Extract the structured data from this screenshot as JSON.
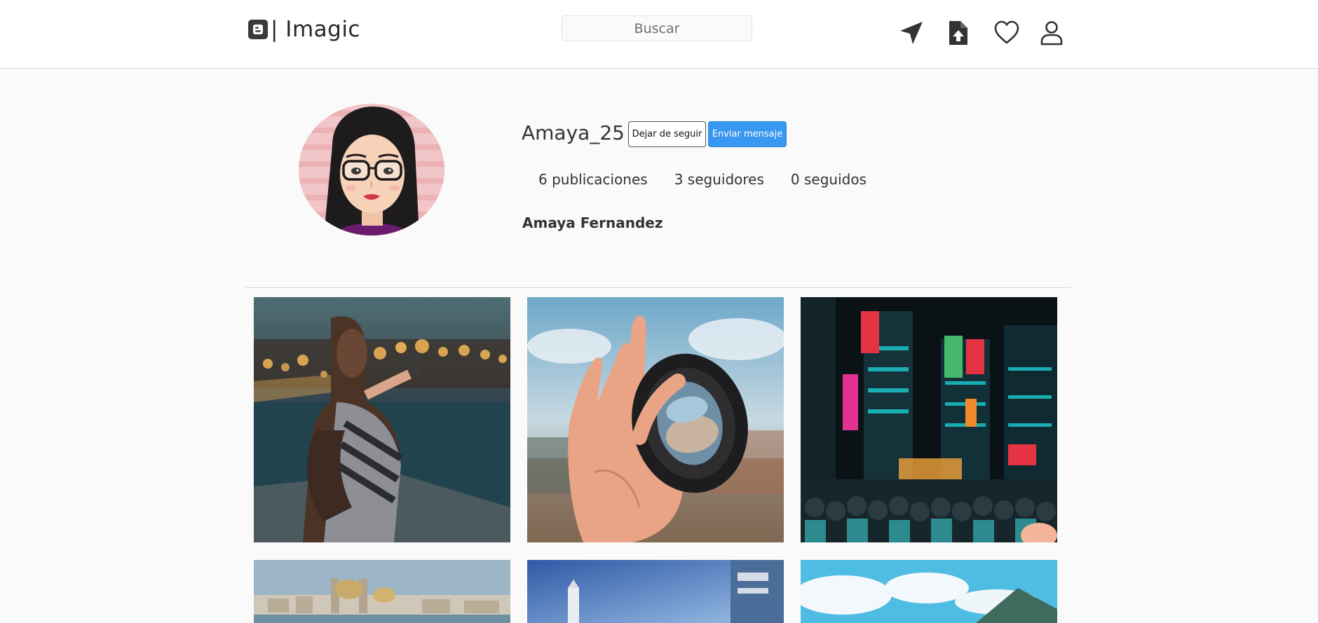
{
  "header": {
    "brand_text": "| Imagic",
    "brand_icon": "blogger-logo-icon",
    "search_placeholder": "Buscar",
    "nav_icons": [
      "location-arrow-icon",
      "file-upload-icon",
      "heart-icon",
      "user-icon"
    ]
  },
  "profile": {
    "username": "Amaya_25",
    "unfollow_label": "Dejar de seguir",
    "message_label": "Enviar mensaje",
    "stats": {
      "posts": "6 publicaciones",
      "followers": "3 seguidores",
      "following": "0 seguidos"
    },
    "full_name": "Amaya Fernandez"
  },
  "gallery": {
    "photos": [
      "woman-photographing-city-lights",
      "hand-holding-camera-lens",
      "neon-city-street-crowd",
      "coastal-city-cathedral",
      "building-blue-sky",
      "mountains-clouds-sky"
    ]
  },
  "colors": {
    "accent": "#3897f0",
    "page_bg": "#fafafa",
    "header_bg": "#ffffff",
    "text": "#333333"
  }
}
